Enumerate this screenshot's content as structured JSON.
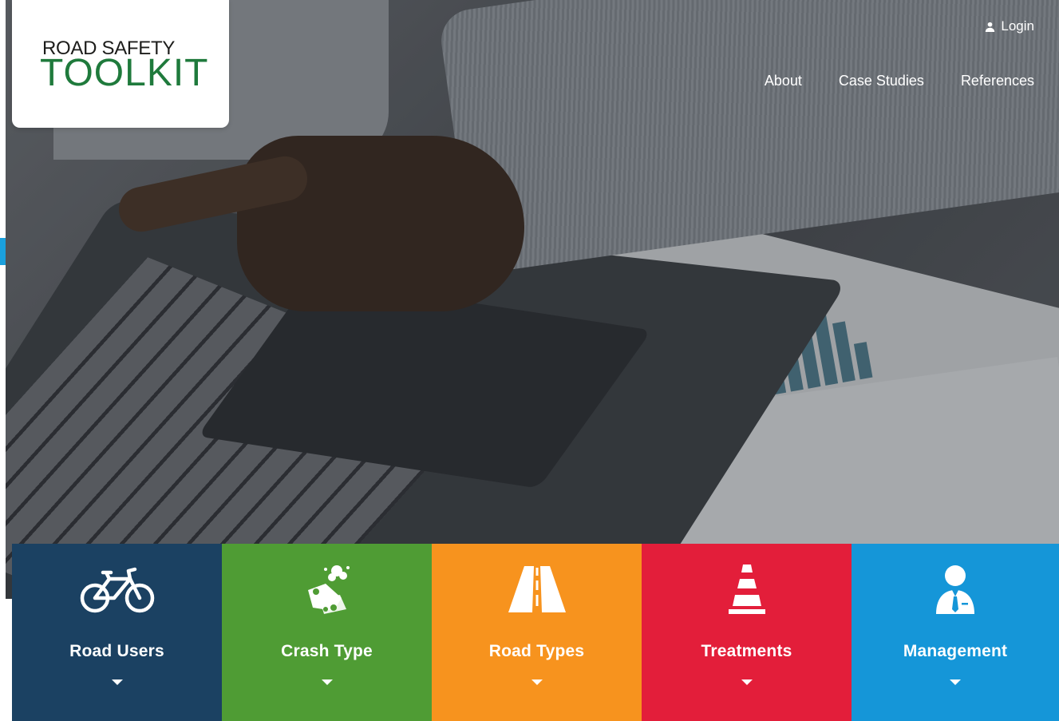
{
  "logo": {
    "line1": "ROAD SAFETY",
    "line2": "TOOLKIT"
  },
  "header": {
    "login_label": "Login",
    "nav": [
      "About",
      "Case Studies",
      "References"
    ]
  },
  "tiles": [
    {
      "label": "Road Users",
      "icon": "bicycle-icon",
      "color": "#1b4162"
    },
    {
      "label": "Crash Type",
      "icon": "car-crash-icon",
      "color": "#4f9c34"
    },
    {
      "label": "Road Types",
      "icon": "road-icon",
      "color": "#f7931e"
    },
    {
      "label": "Treatments",
      "icon": "traffic-cone-icon",
      "color": "#e31e3a"
    },
    {
      "label": "Management",
      "icon": "manager-icon",
      "color": "#1596d8"
    }
  ],
  "colors": {
    "logo_green": "#1f7a3c",
    "accent_blue": "#1aa0dd"
  }
}
